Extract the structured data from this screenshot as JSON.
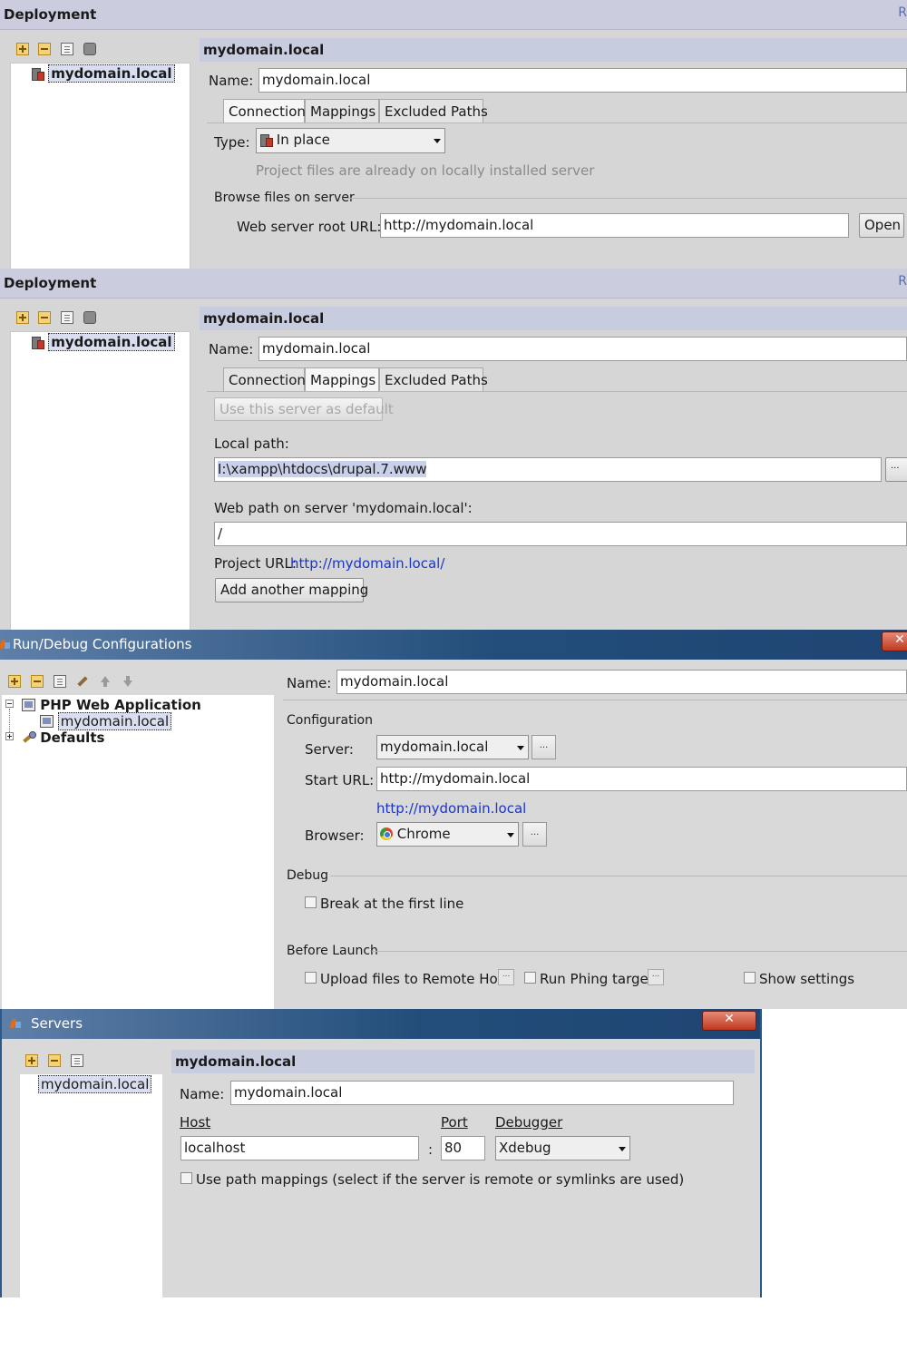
{
  "panel1": {
    "header_title": "Deployment",
    "header_right": "R",
    "tree_item": "mydomain.local",
    "form_title": "mydomain.local",
    "name_label": "Name:",
    "name_value": "mydomain.local",
    "tabs": [
      "Connection",
      "Mappings",
      "Excluded Paths"
    ],
    "active_tab": "Connection",
    "type_label": "Type:",
    "type_value": "In place",
    "type_hint": "Project files are already on locally installed server",
    "group_label": "Browse files on server",
    "web_root_label": "Web server root URL:",
    "web_root_value": "http://mydomain.local",
    "open_button": "Open"
  },
  "panel2": {
    "header_title": "Deployment",
    "header_right": "R",
    "tree_item": "mydomain.local",
    "form_title": "mydomain.local",
    "name_label": "Name:",
    "name_value": "mydomain.local",
    "tabs": [
      "Connection",
      "Mappings",
      "Excluded Paths"
    ],
    "active_tab": "Mappings",
    "default_button": "Use this server as default",
    "local_path_label": "Local path:",
    "local_path_value": "I:\\xampp\\htdocs\\drupal.7.www",
    "browse_button": "...",
    "web_path_label": "Web path on server 'mydomain.local':",
    "web_path_value": "/",
    "project_url_label": "Project URL:",
    "project_url_link": "http://mydomain.local/",
    "add_mapping_button": "Add another mapping"
  },
  "panel3": {
    "window_title": "Run/Debug Configurations",
    "close_glyph": "✕",
    "tree_group": "PHP Web Application",
    "tree_item": "mydomain.local",
    "tree_defaults": "Defaults",
    "name_label": "Name:",
    "name_value": "mydomain.local",
    "configuration_group": "Configuration",
    "server_label": "Server:",
    "server_value": "mydomain.local",
    "start_url_label": "Start URL:",
    "start_url_value": "http://mydomain.local",
    "start_url_link": "http://mydomain.local",
    "browser_label": "Browser:",
    "browser_value": "Chrome",
    "debug_group": "Debug",
    "break_first_line": "Break at the first line",
    "before_launch_group": "Before Launch",
    "upload_files": "Upload files to Remote Host",
    "run_phing": "Run Phing target",
    "show_settings": "Show settings",
    "dots": "..."
  },
  "panel4": {
    "window_title": "Servers",
    "close_glyph": "✕",
    "tree_item": "mydomain.local",
    "form_title": "mydomain.local",
    "name_label": "Name:",
    "name_value": "mydomain.local",
    "host_label": "Host",
    "host_value": "localhost",
    "colon": ":",
    "port_label": "Port",
    "port_value": "80",
    "debugger_label": "Debugger",
    "debugger_value": "Xdebug",
    "use_path_mappings": "Use path mappings (select if the server is remote or symlinks are used)"
  },
  "icons": {
    "add": "add-icon",
    "remove": "remove-icon",
    "copy": "copy-icon",
    "database": "database-icon",
    "server": "server-icon",
    "chrome": "chrome-icon",
    "up": "arrow-up-icon",
    "down": "arrow-down-icon",
    "wrench": "wrench-icon",
    "php": "php-web-app-icon",
    "defaults": "defaults-icon"
  },
  "colors": {
    "header_bg": "#ccccdf",
    "panel_bg": "#d6d6d6",
    "link": "#1a35c8",
    "titlebar": "#224d7a",
    "close_button": "#c0391f"
  }
}
